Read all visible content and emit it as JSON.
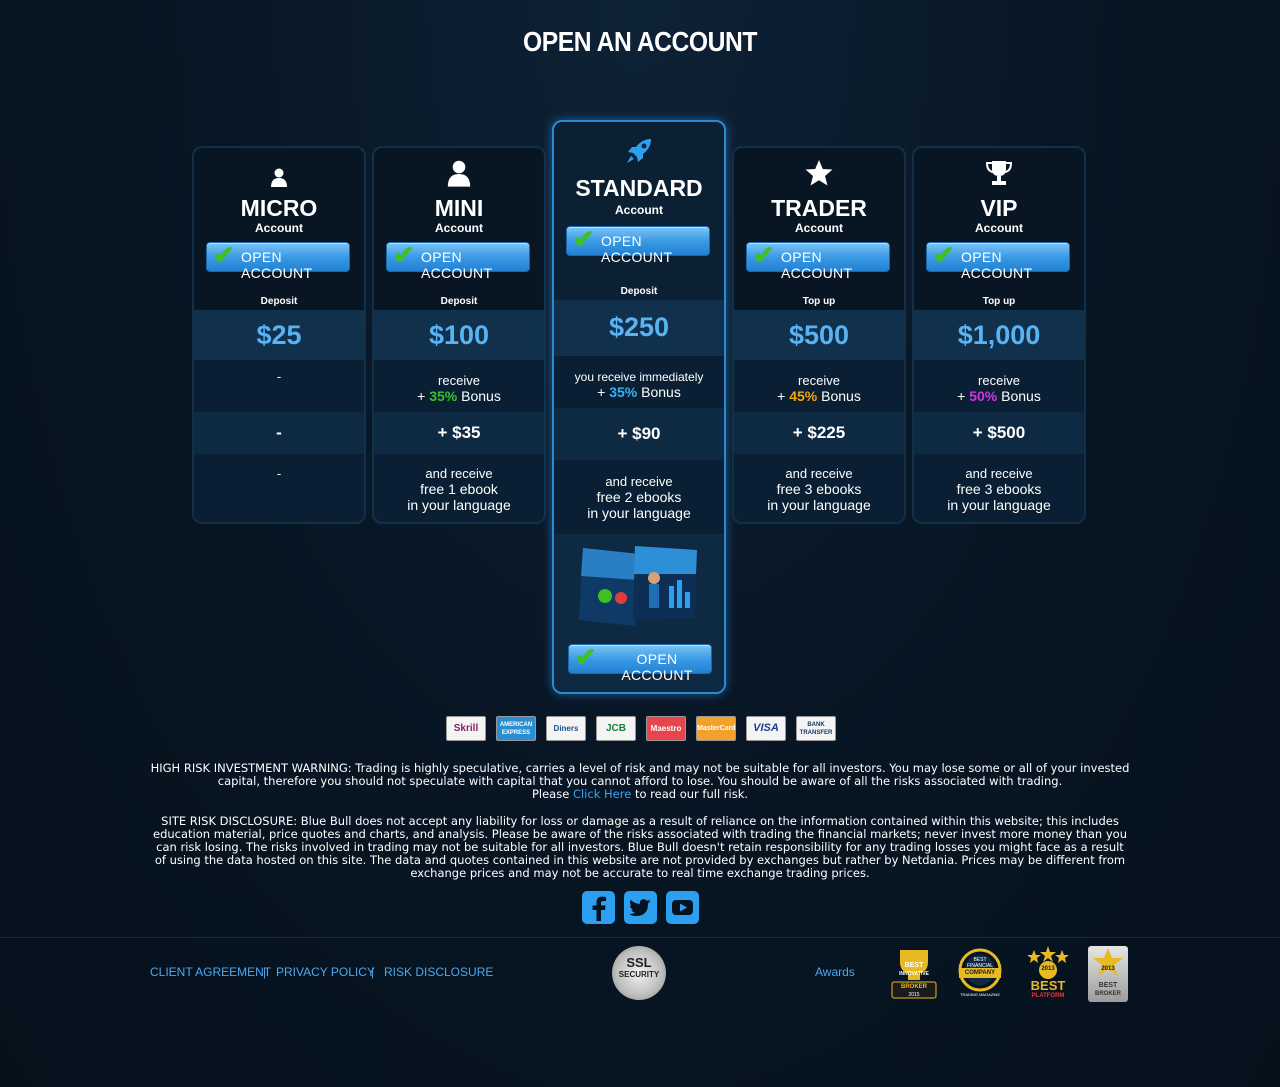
{
  "page_title": "OPEN AN ACCOUNT",
  "open_account_label": "OPEN ACCOUNT",
  "account_sub": "Account",
  "cards": [
    {
      "name": "MICRO",
      "icon": "user-icon",
      "deposit_label": "Deposit",
      "price": "$25",
      "bonus_line1": "-",
      "bonus_amount": "-",
      "ebook_line1": "-"
    },
    {
      "name": "MINI",
      "icon": "user-icon",
      "deposit_label": "Deposit",
      "price": "$100",
      "bonus_line1": "receive",
      "bonus_prefix": "+ ",
      "bonus_pct": "35%",
      "bonus_suffix": " Bonus",
      "bonus_amount": "+ $35",
      "ebook_line1": "and receive",
      "ebook_line2": "free 1 ebook",
      "ebook_line3": "in your language"
    },
    {
      "name": "STANDARD",
      "icon": "rocket-icon",
      "deposit_label": "Deposit",
      "price": "$250",
      "bonus_line1": "you receive immediately",
      "bonus_prefix": "+ ",
      "bonus_pct": "35%",
      "bonus_suffix": " Bonus",
      "bonus_amount": "+ $90",
      "ebook_line1": "and receive",
      "ebook_line2": "free 2 ebooks",
      "ebook_line3": "in your language"
    },
    {
      "name": "TRADER",
      "icon": "star-icon",
      "deposit_label": "Top up",
      "price": "$500",
      "bonus_line1": "receive",
      "bonus_prefix": "+ ",
      "bonus_pct": "45%",
      "bonus_suffix": " Bonus",
      "bonus_amount": "+ $225",
      "ebook_line1": "and receive",
      "ebook_line2": "free 3 ebooks",
      "ebook_line3": "in your language"
    },
    {
      "name": "VIP",
      "icon": "trophy-icon",
      "deposit_label": "Top up",
      "price": "$1,000",
      "bonus_line1": "receive",
      "bonus_prefix": "+ ",
      "bonus_pct": "50%",
      "bonus_suffix": " Bonus",
      "bonus_amount": "+ $500",
      "ebook_line1": "and receive",
      "ebook_line2": "free 3 ebooks",
      "ebook_line3": "in your language"
    }
  ],
  "bonus_colors": {
    "mini": "#39c12d",
    "standard": "#38b3f0",
    "trader": "#f4a50c",
    "vip": "#d233e4"
  },
  "payments": [
    "Skrill",
    "AMERICAN EXPRESS",
    "Diners",
    "JCB",
    "Maestro",
    "MasterCard",
    "VISA",
    "BANK TRANSFER"
  ],
  "warning": {
    "text": "HIGH RISK INVESTMENT WARNING: Trading is highly speculative, carries a level of risk and may not be suitable for all investors. You may lose some or all of your invested capital, therefore you should not speculate with capital that you cannot afford to lose. You should be aware of all the risks associated with trading.",
    "please": "Please ",
    "link": "Click Here",
    "after": " to read our full risk."
  },
  "disclosure": "SITE RISK DISCLOSURE: Blue Bull does not accept any liability for loss or damage as a result of reliance on the information contained within this website; this includes education material, price quotes and charts, and analysis. Please be aware of the risks associated with trading the financial markets; never invest more money than you can risk losing. The risks involved in trading may not be suitable for all investors. Blue Bull doesn't retain responsibility for any trading losses you might face as a result of using the data hosted on this site. The data and quotes contained in this website are not provided by exchanges but rather by Netdania. Prices may be different from exchange prices and may not be accurate to real time exchange trading prices.",
  "social": [
    "facebook-icon",
    "twitter-icon",
    "youtube-icon"
  ],
  "footer": {
    "links": [
      "CLIENT AGREEMENT",
      "PRIVACY POLICY",
      "RISK DISCLOSURE"
    ],
    "separator": "|",
    "ssl_line1": "SSL",
    "ssl_line2": "SECURITY",
    "awards_label": "Awards",
    "award1": {
      "l1": "BEST",
      "l2": "INNOVATIVE",
      "l3": "BROKER",
      "l4": "2015"
    },
    "award2": {
      "l1": "BEST",
      "l2": "FINANCIAL",
      "l3": "COMPANY",
      "l4": "TRADING MAGAZINE"
    },
    "award3": {
      "l1": "2013",
      "l2": "BEST",
      "l3": "PLATFORM"
    },
    "award4": {
      "l1": "2013",
      "l2": "BEST",
      "l3": "BROKER"
    }
  }
}
